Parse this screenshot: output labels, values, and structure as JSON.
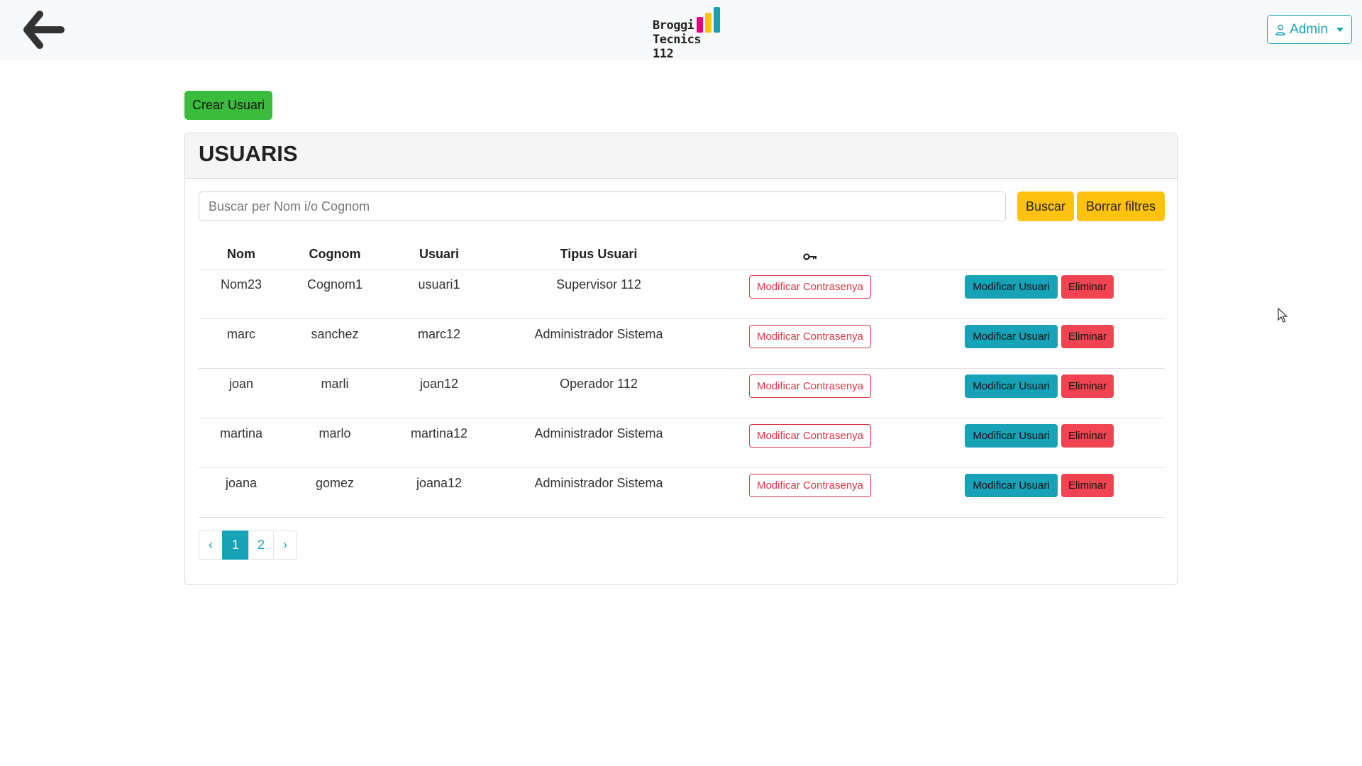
{
  "header": {
    "logo_line1": "Broggi",
    "logo_line2": "Tecnics 112",
    "logo_bar_colors": [
      "#e6007e",
      "#ffc20e",
      "#17a2b8"
    ],
    "admin_label": "Admin",
    "accent_color": "#17a2b8"
  },
  "toolbar": {
    "create_label": "Crear Usuari"
  },
  "card": {
    "title": "USUARIS"
  },
  "search": {
    "placeholder": "Buscar per Nom i/o Cognom",
    "value": "",
    "search_label": "Buscar",
    "clear_label": "Borrar filtres"
  },
  "table": {
    "headers": [
      "Nom",
      "Cognom",
      "Usuari",
      "Tipus Usuari"
    ],
    "key_column_icon": "key-icon",
    "rows": [
      {
        "nom": "Nom23",
        "cognom": "Cognom1",
        "usuari": "usuari1",
        "tipus": "Supervisor 112"
      },
      {
        "nom": "marc",
        "cognom": "sanchez",
        "usuari": "marc12",
        "tipus": "Administrador Sistema"
      },
      {
        "nom": "joan",
        "cognom": "marli",
        "usuari": "joan12",
        "tipus": "Operador 112"
      },
      {
        "nom": "martina",
        "cognom": "marlo",
        "usuari": "martina12",
        "tipus": "Administrador Sistema"
      },
      {
        "nom": "joana",
        "cognom": "gomez",
        "usuari": "joana12",
        "tipus": "Administrador Sistema"
      }
    ],
    "row_actions": {
      "password_label": "Modificar Contrasenya",
      "edit_label": "Modificar Usuari",
      "delete_label": "Eliminar"
    }
  },
  "pagination": {
    "prev": "‹",
    "pages": [
      "1",
      "2"
    ],
    "active_page": "1",
    "next": "›"
  }
}
